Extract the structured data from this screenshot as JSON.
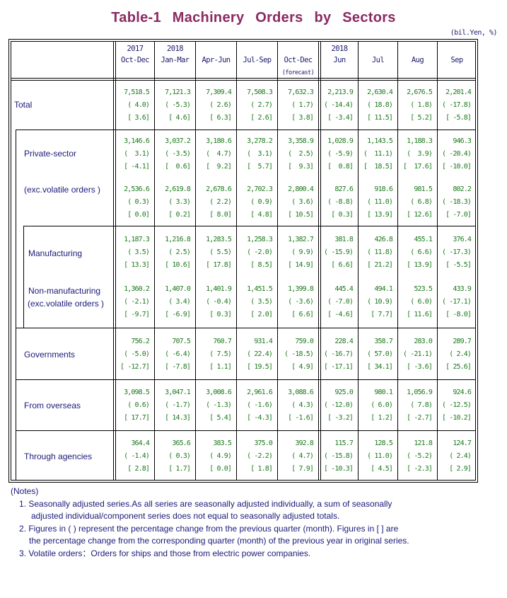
{
  "title": "Table-1   Machinery   Orders   by   Sectors",
  "unit": "(bil.Yen, %)",
  "columns": [
    {
      "line1": "2017",
      "line2": "Oct-Dec",
      "line3": ""
    },
    {
      "line1": "2018",
      "line2": "Jan-Mar",
      "line3": ""
    },
    {
      "line1": "",
      "line2": "Apr-Jun",
      "line3": ""
    },
    {
      "line1": "",
      "line2": "Jul-Sep",
      "line3": ""
    },
    {
      "line1": "",
      "line2": "Oct-Dec",
      "line3": "(forecast)"
    },
    {
      "line1": "2018",
      "line2": "Jun",
      "line3": ""
    },
    {
      "line1": "",
      "line2": "Jul",
      "line3": ""
    },
    {
      "line1": "",
      "line2": "Aug",
      "line3": ""
    },
    {
      "line1": "",
      "line2": "Sep",
      "line3": ""
    }
  ],
  "rows": [
    {
      "label": "Total",
      "values": [
        "7,518.5",
        "7,121.3",
        "7,309.4",
        "7,508.3",
        "7,632.3",
        "2,213.9",
        "2,630.4",
        "2,676.5",
        "2,201.4"
      ],
      "qoq": [
        "( 4.0)",
        "( -5.3)",
        "( 2.6)",
        "( 2.7)",
        "( 1.7)",
        "( -14.4)",
        "( 18.8)",
        "( 1.8)",
        "( -17.8)"
      ],
      "yoy": [
        "[ 3.6]",
        "[ 4.6]",
        "[ 6.3]",
        "[ 2.6]",
        "[ 3.8]",
        "[ -3.4]",
        "[ 11.5]",
        "[ 5.2]",
        "[ -5.8]"
      ]
    },
    {
      "label": "Private-sector",
      "values": [
        "3,146.6",
        "3,037.2",
        "3,180.6",
        "3,278.2",
        "3,358.9",
        "1,028.9",
        "1,143.5",
        "1,188.3",
        "946.3"
      ],
      "qoq": [
        "(  3.1)",
        "( -3.5)",
        "(  4.7)",
        "(  3.1)",
        "(  2.5)",
        "( -5.9)",
        "(  11.1)",
        "(  3.9)",
        "( -20.4)"
      ],
      "yoy": [
        "[ -4.1]",
        "[  0.6]",
        "[  9.2]",
        "[  5.7]",
        "[  9.3]",
        "[  0.8]",
        "[  18.5]",
        "[  17.6]",
        "[ -10.0]"
      ]
    },
    {
      "label": "(exc.volatile orders )",
      "values": [
        "2,536.6",
        "2,619.8",
        "2,678.6",
        "2,702.3",
        "2,800.4",
        "827.6",
        "918.6",
        "981.5",
        "802.2"
      ],
      "qoq": [
        "( 0.3)",
        "( 3.3)",
        "( 2.2)",
        "( 0.9)",
        "( 3.6)",
        "( -8.8)",
        "( 11.0)",
        "( 6.8)",
        "( -18.3)"
      ],
      "yoy": [
        "[ 0.0]",
        "[ 0.2]",
        "[ 8.0]",
        "[ 4.8]",
        "[ 10.5]",
        "[ 0.3]",
        "[ 13.9]",
        "[ 12.6]",
        "[ -7.0]"
      ]
    },
    {
      "label": "Manufacturing",
      "values": [
        "1,187.3",
        "1,216.8",
        "1,283.5",
        "1,258.3",
        "1,382.7",
        "381.8",
        "426.8",
        "455.1",
        "376.4"
      ],
      "qoq": [
        "( 3.5)",
        "( 2.5)",
        "( 5.5)",
        "( -2.0)",
        "( 9.9)",
        "( -15.9)",
        "( 11.8)",
        "( 6.6)",
        "( -17.3)"
      ],
      "yoy": [
        "[ 13.3]",
        "[ 10.6]",
        "[ 17.8]",
        "[ 8.5]",
        "[ 14.9]",
        "[ 6.6]",
        "[ 21.2]",
        "[ 13.9]",
        "[ -5.5]"
      ]
    },
    {
      "label": "Non-manufacturing",
      "label2": "(exc.volatile orders )",
      "values": [
        "1,360.2",
        "1,407.0",
        "1,401.9",
        "1,451.5",
        "1,399.8",
        "445.4",
        "494.1",
        "523.5",
        "433.9"
      ],
      "qoq": [
        "( -2.1)",
        "( 3.4)",
        "( -0.4)",
        "( 3.5)",
        "( -3.6)",
        "( -7.0)",
        "( 10.9)",
        "( 6.0)",
        "( -17.1)"
      ],
      "yoy": [
        "[ -9.7]",
        "[ -6.9]",
        "[ 0.3]",
        "[ 2.0]",
        "[ 6.6]",
        "[ -4.6]",
        "[ 7.7]",
        "[ 11.6]",
        "[ -8.0]"
      ]
    },
    {
      "label": "Governments",
      "values": [
        "756.2",
        "707.5",
        "760.7",
        "931.4",
        "759.0",
        "228.4",
        "358.7",
        "283.0",
        "289.7"
      ],
      "qoq": [
        "( -5.0)",
        "( -6.4)",
        "( 7.5)",
        "( 22.4)",
        "( -18.5)",
        "( -16.7)",
        "( 57.0)",
        "( -21.1)",
        "( 2.4)"
      ],
      "yoy": [
        "[ -12.7]",
        "[ -7.8]",
        "[ 1.1]",
        "[ 19.5]",
        "[ 4.9]",
        "[ -17.1]",
        "[ 34.1]",
        "[ -3.6]",
        "[ 25.6]"
      ]
    },
    {
      "label": "From overseas",
      "values": [
        "3,098.5",
        "3,047.1",
        "3,008.6",
        "2,961.6",
        "3,088.6",
        "925.0",
        "980.1",
        "1,056.9",
        "924.6"
      ],
      "qoq": [
        "( 0.6)",
        "( -1.7)",
        "( -1.3)",
        "( -1.6)",
        "( 4.3)",
        "( -12.0)",
        "( 6.0)",
        "( 7.8)",
        "( -12.5)"
      ],
      "yoy": [
        "[ 17.7]",
        "[ 14.3]",
        "[ 5.4]",
        "[ -4.3]",
        "[ -1.6]",
        "[ -3.2]",
        "[ 1.2]",
        "[ -2.7]",
        "[ -10.2]"
      ]
    },
    {
      "label": "Through agencies",
      "values": [
        "364.4",
        "365.6",
        "383.5",
        "375.0",
        "392.8",
        "115.7",
        "128.5",
        "121.8",
        "124.7"
      ],
      "qoq": [
        "( -1.4)",
        "( 0.3)",
        "( 4.9)",
        "( -2.2)",
        "( 4.7)",
        "( -15.8)",
        "( 11.0)",
        "( -5.2)",
        "( 2.4)"
      ],
      "yoy": [
        "[ 2.8]",
        "[ 1.7]",
        "[ 0.0]",
        "[ 1.8]",
        "[ 7.9]",
        "[ -10.3]",
        "[ 4.5]",
        "[ -2.3]",
        "[ 2.9]"
      ]
    }
  ],
  "notes": {
    "heading": "(Notes)",
    "lines": [
      "1. Seasonally adjusted series.As all series are seasonally adjusted individually, a sum of seasonally",
      "adjusted individual/component series does not equal to seasonally adjusted totals.",
      "2. Figures in ( ) represent the percentage change from the previous quarter (month). Figures in [ ] are",
      "the percentage change from the corresponding quarter (month) of the previous year in original series.",
      "3. Volatile orders：Orders for ships and those from electric power companies."
    ]
  }
}
